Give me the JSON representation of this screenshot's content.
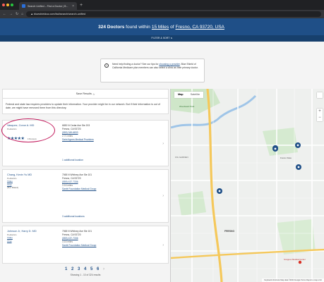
{
  "browser": {
    "tab_title": "Search Unified – Find a Doctor | B...",
    "url": "▲ blueshieldca.com/fad/search/search-unified"
  },
  "header": {
    "count_text": "324 Doctors",
    "found_within": "found within",
    "miles": "15 Miles",
    "of_text": "of",
    "location": "Fresno, CA 93720, USA",
    "filter_sort": "FILTER & SORT"
  },
  "info": {
    "icon": "info-icon",
    "text": "Need help finding a doctor? See our tips for",
    "link": "choosing a provider",
    "text2": ". Blue Shield of California Medicare plan members can also select a clinic as their primary doctor."
  },
  "results": {
    "save_label": "Save Results",
    "disclaimer": "Federal and state law requires providers to update their information. Your provider might be in our network. But if their information is out of date, we might have removed them from this directory.",
    "cards": [
      {
        "name": "Vasquez, Conor A. MD",
        "specialty": "Pediatrics",
        "stars": "★★★★★",
        "reviews": "4 Reviews",
        "address1": "6830 N Cedar Ave Ste 203",
        "address2": "Fresno, CA 93720",
        "phone": "(559) 349-6833",
        "miles": "2.71 miles",
        "group": "Saint Agnes Medical Providers",
        "extra": "1 additional location"
      },
      {
        "name": "Chang, Kevin Yu MD",
        "specialty": "Pediatrics",
        "link1": "Video",
        "link2": "Chat",
        "fax": "(Not Rated)",
        "address1": "7065 N Whitney Ave Ste 101",
        "address2": "Fresno, CA 93720",
        "phone": "(559) 437-7336",
        "miles": "3.16 miles",
        "group": "Santé Foundation Medical Group",
        "extra": "3 additional locations"
      },
      {
        "name": "Johnson Jr, Harry D. MD",
        "specialty": "Pediatrics",
        "link1": "Video",
        "link2": "Chat",
        "address1": "7065 N Whitney Ave Ste 101",
        "address2": "Fresno, CA 93720",
        "phone": "(559) 437-7336",
        "miles": "3.16 miles",
        "group": "Santé Foundation Medical Group"
      }
    ],
    "pages": [
      "1",
      "2",
      "3",
      "4",
      "5",
      "6"
    ],
    "next": "›",
    "showing": "Showing 1 - 10 of 324 results"
  },
  "map": {
    "tab_map": "Map",
    "tab_satellite": "Satellite",
    "zoom_in": "+",
    "zoom_out": "−",
    "labels": {
      "l1": "Woodward Park",
      "l2": "FIG GARDEN",
      "l3": "FRESNO",
      "l4": "St Agnes Medical Center",
      "l5": "Fresno State"
    },
    "footer": "Keyboard shortcuts   Map data ©2024 Google   Terms   Report a map error"
  },
  "colors": {
    "brand": "#1f4f87",
    "highlight": "#c2185b"
  }
}
